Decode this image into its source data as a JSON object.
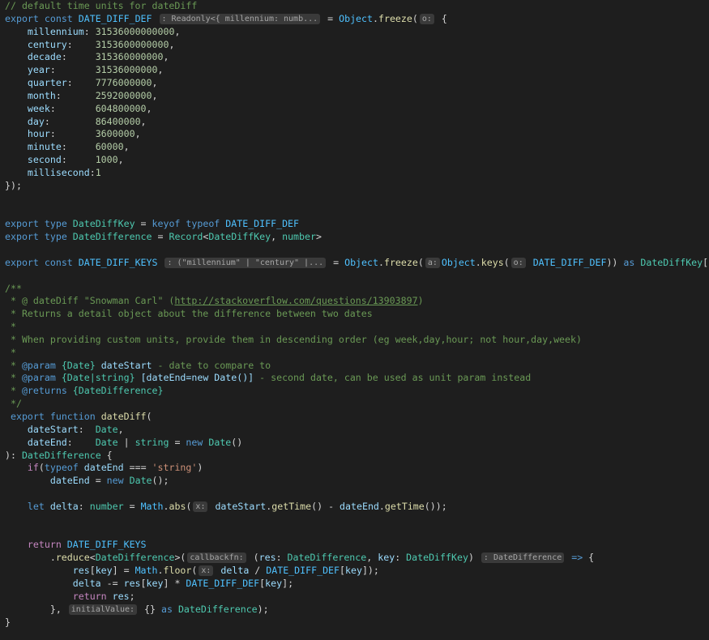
{
  "editor": {
    "theme_colors": {
      "background": "#1e1e1e",
      "comment": "#6a9955",
      "keyword": "#569cd6",
      "control": "#c586c0",
      "variable": "#9cdcfe",
      "constant": "#4fc1ff",
      "type": "#4ec9b0",
      "function": "#dcdcaa",
      "number": "#b5cea8",
      "string": "#ce9178",
      "plain": "#d4d4d4",
      "inlay_hint_bg": "#3a3a3a",
      "inlay_hint_fg": "#a7a7a7"
    },
    "lines": [
      [
        [
          "c",
          "// default time units for dateDiff"
        ]
      ],
      [
        [
          "k",
          "export"
        ],
        [
          "p",
          " "
        ],
        [
          "k",
          "const"
        ],
        [
          "p",
          " "
        ],
        [
          "C",
          "DATE_DIFF_DEF"
        ],
        [
          "p",
          " "
        ],
        [
          "h",
          ": Readonly<{ millennium: numb..."
        ],
        [
          "p",
          " = "
        ],
        [
          "C",
          "Object"
        ],
        [
          "p",
          "."
        ],
        [
          "f",
          "freeze"
        ],
        [
          "p",
          "("
        ],
        [
          "h",
          "o:"
        ],
        [
          "p",
          " {"
        ]
      ],
      [
        [
          "p",
          "    "
        ],
        [
          "v",
          "millennium"
        ],
        [
          "p",
          ": "
        ],
        [
          "n",
          "31536000000000"
        ],
        [
          "p",
          ","
        ]
      ],
      [
        [
          "p",
          "    "
        ],
        [
          "v",
          "century"
        ],
        [
          "p",
          ":    "
        ],
        [
          "n",
          "3153600000000"
        ],
        [
          "p",
          ","
        ]
      ],
      [
        [
          "p",
          "    "
        ],
        [
          "v",
          "decade"
        ],
        [
          "p",
          ":     "
        ],
        [
          "n",
          "315360000000"
        ],
        [
          "p",
          ","
        ]
      ],
      [
        [
          "p",
          "    "
        ],
        [
          "v",
          "year"
        ],
        [
          "p",
          ":       "
        ],
        [
          "n",
          "31536000000"
        ],
        [
          "p",
          ","
        ]
      ],
      [
        [
          "p",
          "    "
        ],
        [
          "v",
          "quarter"
        ],
        [
          "p",
          ":    "
        ],
        [
          "n",
          "7776000000"
        ],
        [
          "p",
          ","
        ]
      ],
      [
        [
          "p",
          "    "
        ],
        [
          "v",
          "month"
        ],
        [
          "p",
          ":      "
        ],
        [
          "n",
          "2592000000"
        ],
        [
          "p",
          ","
        ]
      ],
      [
        [
          "p",
          "    "
        ],
        [
          "v",
          "week"
        ],
        [
          "p",
          ":       "
        ],
        [
          "n",
          "604800000"
        ],
        [
          "p",
          ","
        ]
      ],
      [
        [
          "p",
          "    "
        ],
        [
          "v",
          "day"
        ],
        [
          "p",
          ":        "
        ],
        [
          "n",
          "86400000"
        ],
        [
          "p",
          ","
        ]
      ],
      [
        [
          "p",
          "    "
        ],
        [
          "v",
          "hour"
        ],
        [
          "p",
          ":       "
        ],
        [
          "n",
          "3600000"
        ],
        [
          "p",
          ","
        ]
      ],
      [
        [
          "p",
          "    "
        ],
        [
          "v",
          "minute"
        ],
        [
          "p",
          ":     "
        ],
        [
          "n",
          "60000"
        ],
        [
          "p",
          ","
        ]
      ],
      [
        [
          "p",
          "    "
        ],
        [
          "v",
          "second"
        ],
        [
          "p",
          ":     "
        ],
        [
          "n",
          "1000"
        ],
        [
          "p",
          ","
        ]
      ],
      [
        [
          "p",
          "    "
        ],
        [
          "v",
          "millisecond"
        ],
        [
          "p",
          ":"
        ],
        [
          "n",
          "1"
        ]
      ],
      [
        [
          "p",
          "});"
        ]
      ],
      [],
      [],
      [
        [
          "k",
          "export"
        ],
        [
          "p",
          " "
        ],
        [
          "k",
          "type"
        ],
        [
          "p",
          " "
        ],
        [
          "t",
          "DateDiffKey"
        ],
        [
          "p",
          " = "
        ],
        [
          "k",
          "keyof"
        ],
        [
          "p",
          " "
        ],
        [
          "k",
          "typeof"
        ],
        [
          "p",
          " "
        ],
        [
          "C",
          "DATE_DIFF_DEF"
        ]
      ],
      [
        [
          "k",
          "export"
        ],
        [
          "p",
          " "
        ],
        [
          "k",
          "type"
        ],
        [
          "p",
          " "
        ],
        [
          "t",
          "DateDifference"
        ],
        [
          "p",
          " = "
        ],
        [
          "t",
          "Record"
        ],
        [
          "p",
          "<"
        ],
        [
          "t",
          "DateDiffKey"
        ],
        [
          "p",
          ", "
        ],
        [
          "t",
          "number"
        ],
        [
          "p",
          ">"
        ]
      ],
      [],
      [
        [
          "k",
          "export"
        ],
        [
          "p",
          " "
        ],
        [
          "k",
          "const"
        ],
        [
          "p",
          " "
        ],
        [
          "C",
          "DATE_DIFF_KEYS"
        ],
        [
          "p",
          " "
        ],
        [
          "h",
          ": (\"millennium\" | \"century\" |..."
        ],
        [
          "p",
          " = "
        ],
        [
          "C",
          "Object"
        ],
        [
          "p",
          "."
        ],
        [
          "f",
          "freeze"
        ],
        [
          "p",
          "("
        ],
        [
          "h",
          "a:"
        ],
        [
          "C",
          "Object"
        ],
        [
          "p",
          "."
        ],
        [
          "f",
          "keys"
        ],
        [
          "p",
          "("
        ],
        [
          "h",
          "o:"
        ],
        [
          "p",
          " "
        ],
        [
          "C",
          "DATE_DIFF_DEF"
        ],
        [
          "p",
          ")) "
        ],
        [
          "k",
          "as"
        ],
        [
          "p",
          " "
        ],
        [
          "t",
          "DateDiffKey"
        ],
        [
          "p",
          "[]"
        ]
      ],
      [],
      [
        [
          "c",
          "/**"
        ]
      ],
      [
        [
          "c",
          " * @ dateDiff \"Snowman Carl\" ("
        ],
        [
          "l",
          "http://stackoverflow.com/questions/13903897"
        ],
        [
          "c",
          ")"
        ]
      ],
      [
        [
          "c",
          " * Returns a detail object about the difference between two dates"
        ]
      ],
      [
        [
          "c",
          " *"
        ]
      ],
      [
        [
          "c",
          " * When providing custom units, provide them in descending order (eg week,day,hour; not hour,day,week)"
        ]
      ],
      [
        [
          "c",
          " *"
        ]
      ],
      [
        [
          "c",
          " * "
        ],
        [
          "g",
          "@param"
        ],
        [
          "c",
          " "
        ],
        [
          "j",
          "{Date}"
        ],
        [
          "c",
          " "
        ],
        [
          "a",
          "dateStart"
        ],
        [
          "c",
          " - date to compare to"
        ]
      ],
      [
        [
          "c",
          " * "
        ],
        [
          "g",
          "@param"
        ],
        [
          "c",
          " "
        ],
        [
          "j",
          "{Date|string}"
        ],
        [
          "c",
          " "
        ],
        [
          "a",
          "[dateEnd=new Date()]"
        ],
        [
          "c",
          " - second date, can be used as unit param instead"
        ]
      ],
      [
        [
          "c",
          " * "
        ],
        [
          "g",
          "@returns"
        ],
        [
          "c",
          " "
        ],
        [
          "j",
          "{DateDifference}"
        ]
      ],
      [
        [
          "c",
          " */"
        ]
      ],
      [
        [
          "p",
          " "
        ],
        [
          "k",
          "export"
        ],
        [
          "p",
          " "
        ],
        [
          "k",
          "function"
        ],
        [
          "p",
          " "
        ],
        [
          "f",
          "dateDiff"
        ],
        [
          "p",
          "("
        ]
      ],
      [
        [
          "p",
          "    "
        ],
        [
          "v",
          "dateStart"
        ],
        [
          "p",
          ":  "
        ],
        [
          "t",
          "Date"
        ],
        [
          "p",
          ","
        ]
      ],
      [
        [
          "p",
          "    "
        ],
        [
          "v",
          "dateEnd"
        ],
        [
          "p",
          ":    "
        ],
        [
          "t",
          "Date"
        ],
        [
          "p",
          " | "
        ],
        [
          "t",
          "string"
        ],
        [
          "p",
          " = "
        ],
        [
          "k",
          "new"
        ],
        [
          "p",
          " "
        ],
        [
          "t",
          "Date"
        ],
        [
          "p",
          "()"
        ]
      ],
      [
        [
          "p",
          "): "
        ],
        [
          "t",
          "DateDifference"
        ],
        [
          "p",
          " {"
        ]
      ],
      [
        [
          "p",
          "    "
        ],
        [
          "x",
          "if"
        ],
        [
          "p",
          "("
        ],
        [
          "k",
          "typeof"
        ],
        [
          "p",
          " "
        ],
        [
          "v",
          "dateEnd"
        ],
        [
          "p",
          " === "
        ],
        [
          "s",
          "'string'"
        ],
        [
          "p",
          ")"
        ]
      ],
      [
        [
          "p",
          "        "
        ],
        [
          "v",
          "dateEnd"
        ],
        [
          "p",
          " = "
        ],
        [
          "k",
          "new"
        ],
        [
          "p",
          " "
        ],
        [
          "t",
          "Date"
        ],
        [
          "p",
          "();"
        ]
      ],
      [],
      [
        [
          "p",
          "    "
        ],
        [
          "k",
          "let"
        ],
        [
          "p",
          " "
        ],
        [
          "v",
          "delta"
        ],
        [
          "p",
          ": "
        ],
        [
          "t",
          "number"
        ],
        [
          "p",
          " = "
        ],
        [
          "C",
          "Math"
        ],
        [
          "p",
          "."
        ],
        [
          "f",
          "abs"
        ],
        [
          "p",
          "("
        ],
        [
          "h",
          "x:"
        ],
        [
          "p",
          " "
        ],
        [
          "v",
          "dateStart"
        ],
        [
          "p",
          "."
        ],
        [
          "f",
          "getTime"
        ],
        [
          "p",
          "() - "
        ],
        [
          "v",
          "dateEnd"
        ],
        [
          "p",
          "."
        ],
        [
          "f",
          "getTime"
        ],
        [
          "p",
          "());"
        ]
      ],
      [],
      [],
      [
        [
          "p",
          "    "
        ],
        [
          "x",
          "return"
        ],
        [
          "p",
          " "
        ],
        [
          "C",
          "DATE_DIFF_KEYS"
        ]
      ],
      [
        [
          "p",
          "        ."
        ],
        [
          "f",
          "reduce"
        ],
        [
          "p",
          "<"
        ],
        [
          "t",
          "DateDifference"
        ],
        [
          "p",
          ">("
        ],
        [
          "h",
          "callbackfn:"
        ],
        [
          "p",
          " ("
        ],
        [
          "v",
          "res"
        ],
        [
          "p",
          ": "
        ],
        [
          "t",
          "DateDifference"
        ],
        [
          "p",
          ", "
        ],
        [
          "v",
          "key"
        ],
        [
          "p",
          ": "
        ],
        [
          "t",
          "DateDiffKey"
        ],
        [
          "p",
          ") "
        ],
        [
          "h",
          ": DateDifference"
        ],
        [
          "p",
          " "
        ],
        [
          "k",
          "=>"
        ],
        [
          "p",
          " {"
        ]
      ],
      [
        [
          "p",
          "            "
        ],
        [
          "v",
          "res"
        ],
        [
          "p",
          "["
        ],
        [
          "v",
          "key"
        ],
        [
          "p",
          "] = "
        ],
        [
          "C",
          "Math"
        ],
        [
          "p",
          "."
        ],
        [
          "f",
          "floor"
        ],
        [
          "p",
          "("
        ],
        [
          "h",
          "x:"
        ],
        [
          "p",
          " "
        ],
        [
          "v",
          "delta"
        ],
        [
          "p",
          " / "
        ],
        [
          "C",
          "DATE_DIFF_DEF"
        ],
        [
          "p",
          "["
        ],
        [
          "v",
          "key"
        ],
        [
          "p",
          "]);"
        ]
      ],
      [
        [
          "p",
          "            "
        ],
        [
          "v",
          "delta"
        ],
        [
          "p",
          " -= "
        ],
        [
          "v",
          "res"
        ],
        [
          "p",
          "["
        ],
        [
          "v",
          "key"
        ],
        [
          "p",
          "] * "
        ],
        [
          "C",
          "DATE_DIFF_DEF"
        ],
        [
          "p",
          "["
        ],
        [
          "v",
          "key"
        ],
        [
          "p",
          "];"
        ]
      ],
      [
        [
          "p",
          "            "
        ],
        [
          "x",
          "return"
        ],
        [
          "p",
          " "
        ],
        [
          "v",
          "res"
        ],
        [
          "p",
          ";"
        ]
      ],
      [
        [
          "p",
          "        }, "
        ],
        [
          "h",
          "initialValue:"
        ],
        [
          "p",
          " {} "
        ],
        [
          "k",
          "as"
        ],
        [
          "p",
          " "
        ],
        [
          "t",
          "DateDifference"
        ],
        [
          "p",
          ");"
        ]
      ],
      [
        [
          "p",
          "}"
        ]
      ]
    ]
  }
}
